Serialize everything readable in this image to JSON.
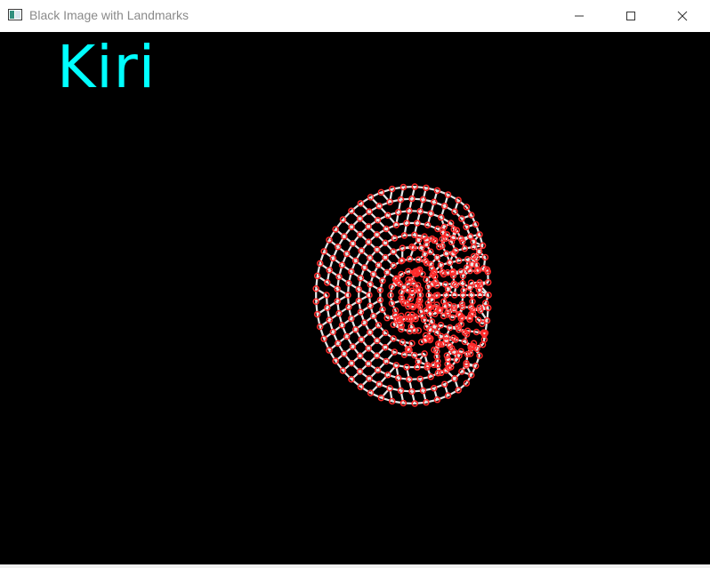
{
  "window": {
    "title": "Black Image with Landmarks",
    "icon": "opencv-window-icon"
  },
  "controls": {
    "minimize_icon": "minimize-icon",
    "maximize_icon": "maximize-icon",
    "close_icon": "close-icon"
  },
  "canvas": {
    "background": "#000000",
    "label": "Kiri",
    "label_color": "#00ffff",
    "mesh_line_color": "#e6e6e6",
    "landmark_color": "#ff2a2a",
    "content": "face-landmark-mesh"
  }
}
